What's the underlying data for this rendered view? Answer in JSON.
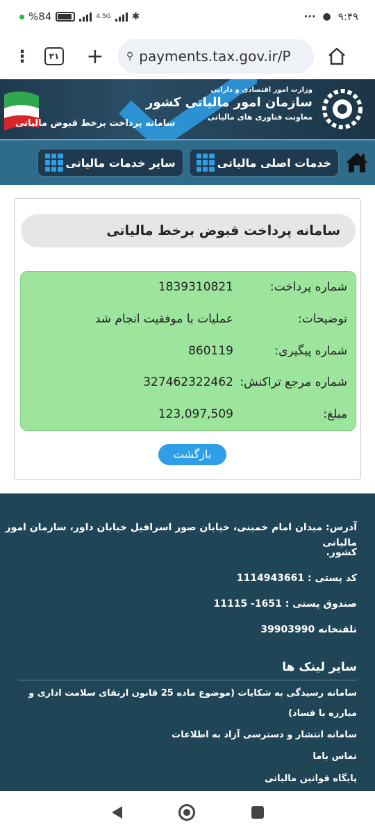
{
  "status_bar": {
    "battery_percent": "%84",
    "network": "4.5G",
    "time": "۹:۴۹",
    "more_icon": "ellipsis-icon",
    "chat_icon": "message-icon"
  },
  "browser": {
    "tab_count": "۳۱",
    "url": "payments.tax.gov.ir/P"
  },
  "site_header": {
    "ministry": "وزارت امور اقتصادی و دارایی",
    "org_name": "سازمان امور مالیاتی کشور",
    "deputy": "معاونت فناوری های مالیاتی",
    "system_title": "سامانه پرداخت برخط قبوض مالیاتی"
  },
  "nav": {
    "main_services": "خدمات اصلی مالیاتی",
    "other_services": "سایر خدمات مالیاتی"
  },
  "panel": {
    "title": "سامانه پرداخت قبوض برخط مالیاتی",
    "rows": [
      {
        "label": "شماره پرداخت:",
        "value": "1839310821"
      },
      {
        "label": "توضیحات:",
        "value": "عملیات با موفقیت انجام شد"
      },
      {
        "label": "شماره پیگیری:",
        "value": "860119"
      },
      {
        "label": "شماره مرجع تراکنش:",
        "value": "327462322462"
      },
      {
        "label": "مبلغ:",
        "value": "123,097,509"
      }
    ],
    "back_label": "بازگشت"
  },
  "footer": {
    "address_line1": "آدرس: میدان امام خمینی، خیابان صور اسرافیل خیابان داور، سازمان امور مالیاتی",
    "address_line2": "کشور.",
    "postal_code": "کد پستی : 1114943661",
    "po_box": "صندوق پستی : 1651- 11115",
    "phone": "تلفنخانه 39903990",
    "links_title": "سایر لینک ها",
    "links": [
      "سامانه رسیدگی به شکایات (موضوع ماده 25 قانون ارتقای سلامت اداری و",
      "مبارزه با فساد)",
      "سامانه انتشار و دسترسی آزاد به اطلاعات",
      "تماس باما",
      "پایگاه قوانین مالیاتی"
    ]
  },
  "colors": {
    "header_bg": "#1f3a4f",
    "nav_bg": "#2f6b8a",
    "success_bg": "#9de59d",
    "button_blue": "#2e9fe6",
    "footer_bg": "#1f4557"
  }
}
